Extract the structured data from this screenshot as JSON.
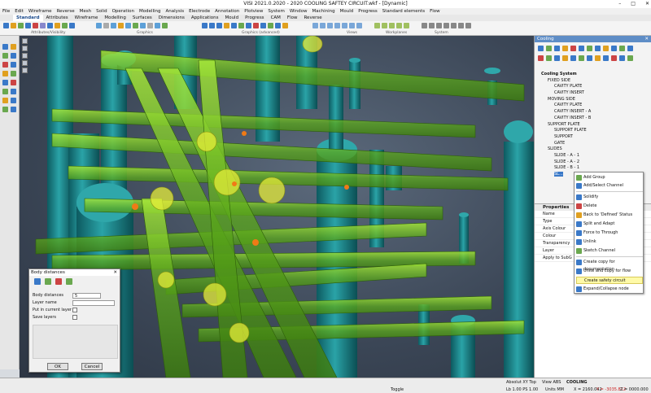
{
  "app": {
    "title": "VISI 2021.0.2020 - 2020 COOLING SAFTEY CIRCUIT.wkf - [Dynamic]"
  },
  "menu": [
    "File",
    "Edit",
    "Wireframe",
    "Reverse",
    "Mesh",
    "Solid",
    "Operation",
    "Modelling",
    "Analysis",
    "Electrode",
    "Annotation",
    "Plotview",
    "System",
    "Window",
    "Machining",
    "Mould",
    "Progress",
    "Standard elements",
    "Flow"
  ],
  "ribbon": {
    "tabs": [
      "Standard",
      "Attributes",
      "Wireframe",
      "Modelling",
      "Surfaces",
      "Dimensions",
      "Applications",
      "Mould",
      "Progress",
      "CAM",
      "Flow",
      "Reverse"
    ],
    "groups": [
      "Attributes/Visibility",
      "Graphics",
      "Graphics (advanced)",
      "Views",
      "Workplanes",
      "System"
    ]
  },
  "cooling_panel": {
    "title": "Cooling",
    "tree": [
      {
        "label": "Cooling System",
        "level": 0
      },
      {
        "label": "FIXED SIDE",
        "level": 1
      },
      {
        "label": "CAVITY PLATE",
        "level": 2
      },
      {
        "label": "CAVITY INSERT",
        "level": 2
      },
      {
        "label": "MOVING SIDE",
        "level": 1
      },
      {
        "label": "CAVITY PLATE",
        "level": 2
      },
      {
        "label": "CAVITY INSERT - A",
        "level": 2
      },
      {
        "label": "CAVITY INSERT - B",
        "level": 2
      },
      {
        "label": "SUPPORT PLATE",
        "level": 1
      },
      {
        "label": "SUPPORT PLATE",
        "level": 2
      },
      {
        "label": "SUPPORT",
        "level": 2
      },
      {
        "label": "GATE",
        "level": 2
      },
      {
        "label": "SLIDES",
        "level": 1
      },
      {
        "label": "SLIDE - A - 1",
        "level": 2
      },
      {
        "label": "SLIDE - A - 2",
        "level": 2
      },
      {
        "label": "SLIDE - B - 1",
        "level": 2
      },
      {
        "label": "SL...",
        "level": 2
      }
    ]
  },
  "properties": {
    "title": "Properties",
    "rows": [
      "Name",
      "Type",
      "Axis Colour",
      "Colour",
      "Transparency",
      "Layer",
      "Apply to SubG"
    ]
  },
  "context_menu": {
    "items": [
      "Add Group",
      "Add/Select Channel",
      "Solidify",
      "Delete",
      "Back to 'Defined' Status",
      "Split and Adapt",
      "Force to Through",
      "Unlink",
      "Sketch Channel",
      "Create copy for documentation",
      "Unite and copy for flow",
      "Create safety circuit",
      "Expand/Collapse node"
    ],
    "highlighted": "Create safety circuit"
  },
  "dialog": {
    "title": "Body distances",
    "body_distances_label": "Body distances",
    "body_distances_value": "5",
    "layer_name_label": "Layer name",
    "put_in_layer_label": "Put in current layer",
    "save_layers_label": "Save layers",
    "ok": "OK",
    "cancel": "Cancel"
  },
  "status": {
    "toggle": "Toggle",
    "view": "Absolut XY Top",
    "view_abs": "View ABS",
    "layer": "COOLING",
    "lb": "Lb 1.00 PS 1.00",
    "units": "Units MM",
    "x": "X = 2160.042",
    "y": "Y = -3035.812",
    "z": "Z = 0000.000"
  },
  "colors": {
    "accent": "#5e8dc6",
    "cooling_channel": "#7fd21a",
    "screw": "#1f8a8f",
    "highlight_item": "#fffaa8"
  }
}
